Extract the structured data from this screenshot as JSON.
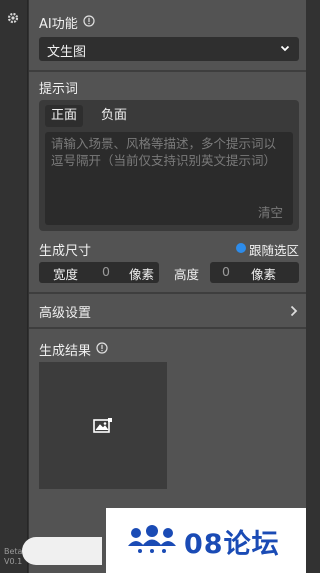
{
  "rail": {
    "gear_icon": "gear-icon",
    "beta": "Beta",
    "version": "V0.1"
  },
  "ai_feature": {
    "label": "AI功能",
    "selected": "文生图"
  },
  "prompt": {
    "label": "提示词",
    "tabs": [
      "正面",
      "负面"
    ],
    "placeholder_line1": "请输入场景、风格等描述，多个提示词以",
    "placeholder_line2": "逗号隔开（当前仅支持识别英文提示词）",
    "clear": "清空"
  },
  "size": {
    "label": "生成尺寸",
    "follow_selection": "跟随选区",
    "width_label": "宽度",
    "width_value": "0",
    "width_unit": "像素",
    "height_label": "高度",
    "height_value": "0",
    "height_unit": "像素"
  },
  "advanced": {
    "label": "高级设置"
  },
  "result": {
    "label": "生成结果"
  },
  "watermark": {
    "text": "08论坛"
  },
  "colors": {
    "panel": "#535353",
    "rail": "#323232",
    "accent": "#2d8ceb",
    "watermark": "#1a4bb5"
  }
}
